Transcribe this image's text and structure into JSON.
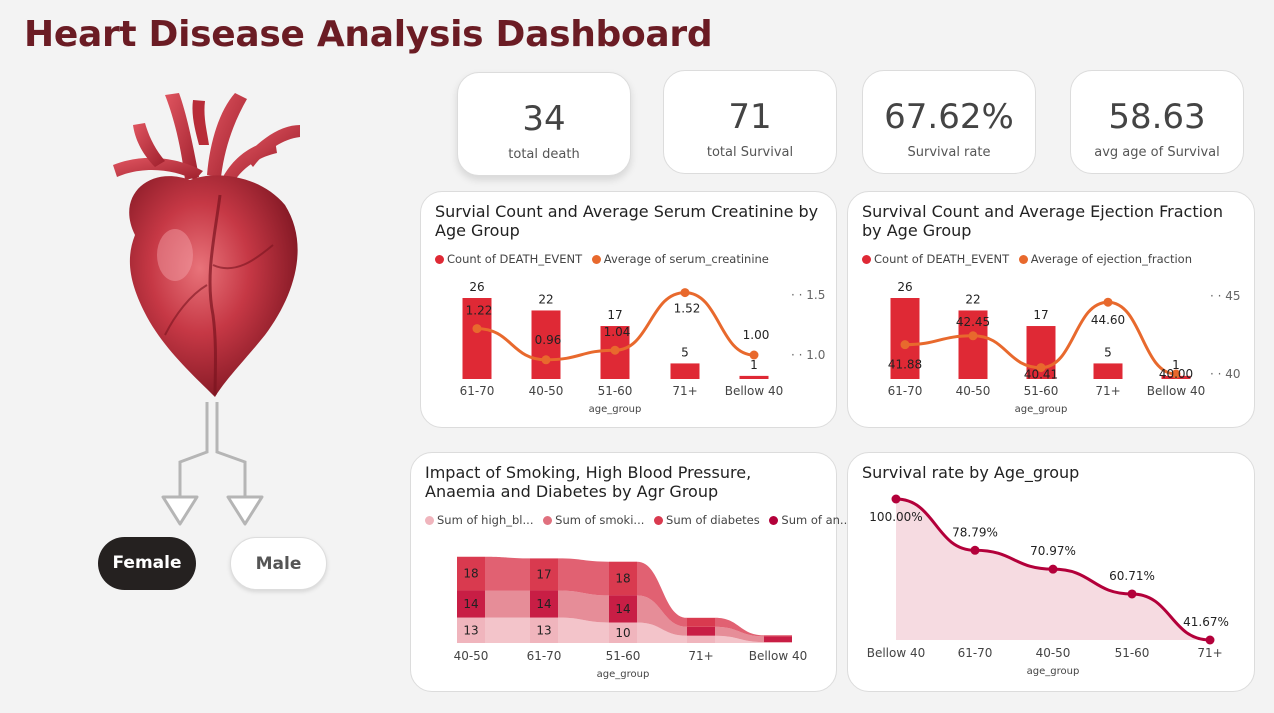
{
  "page": {
    "title": "Heart Disease Analysis Dashboard"
  },
  "kpis": [
    {
      "value": "34",
      "label": "total death"
    },
    {
      "value": "71",
      "label": "total Survival"
    },
    {
      "value": "67.62%",
      "label": "Survival rate"
    },
    {
      "value": "58.63",
      "label": "avg age of Survival"
    }
  ],
  "filters": {
    "female_label": "Female",
    "male_label": "Male",
    "selected": "Female"
  },
  "colors": {
    "bar_red": "#df2935",
    "line_orange": "#e8692d",
    "title_maroon": "#6b1c24",
    "survival_line": "#b3003a",
    "survival_fill": "#f6dbe1"
  },
  "chart_data": [
    {
      "type": "bar",
      "title": "Survial Count and Average Serum Creatinine by Age Group",
      "xlabel": "age_group",
      "categories": [
        "61-70",
        "40-50",
        "51-60",
        "71+",
        "Bellow 40"
      ],
      "series": [
        {
          "name": "Count of DEATH_EVENT",
          "values": [
            26,
            22,
            17,
            5,
            1
          ]
        },
        {
          "name": "Average of serum_creatinine",
          "values": [
            1.22,
            0.96,
            1.04,
            1.52,
            1.0
          ]
        }
      ],
      "bar_labels": [
        "26",
        "22",
        "17",
        "5",
        "1"
      ],
      "line_labels": [
        "1.22",
        "0.96",
        "1.04",
        "1.52",
        "1.00"
      ],
      "y2_ticks": [
        "1.5",
        "1.0"
      ],
      "y2_tick_values": [
        1.5,
        1.0
      ]
    },
    {
      "type": "bar",
      "title": "Survival Count and Average Ejection Fraction by Age Group",
      "xlabel": "age_group",
      "categories": [
        "61-70",
        "40-50",
        "51-60",
        "71+",
        "Bellow 40"
      ],
      "series": [
        {
          "name": "Count of DEATH_EVENT",
          "values": [
            26,
            22,
            17,
            5,
            1
          ]
        },
        {
          "name": "Average of ejection_fraction",
          "values": [
            41.88,
            42.45,
            40.41,
            44.6,
            40.0
          ]
        }
      ],
      "bar_labels": [
        "26",
        "22",
        "17",
        "5",
        "1"
      ],
      "line_labels": [
        "41.88",
        "42.45",
        "40.41",
        "44.60",
        "40.00"
      ],
      "y2_ticks": [
        "45",
        "40"
      ],
      "y2_tick_values": [
        45,
        40
      ]
    },
    {
      "type": "area",
      "title": "Impact of Smoking, High Blood Pressure, Anaemia and Diabetes by Agr Group",
      "xlabel": "age_group",
      "categories": [
        "40-50",
        "61-70",
        "51-60",
        "71+",
        "Bellow 40"
      ],
      "legend": [
        "Sum of high_bl...",
        "Sum of smoki...",
        "Sum of diabetes",
        "Sum of an..."
      ],
      "legend_colors": [
        "#f0b5bd",
        "#e0707e",
        "#d93a4f",
        "#b3003a"
      ],
      "series": [
        {
          "name": "Sum of high_bl...",
          "values": [
            13,
            13,
            10,
            2,
            0
          ]
        },
        {
          "name": "Sum of smoki...",
          "values": [
            14,
            14,
            14,
            3,
            1
          ]
        },
        {
          "name": "Sum of diabetes",
          "values": [
            18,
            17,
            18,
            3,
            0
          ]
        }
      ],
      "labels": [
        {
          "cat": 0,
          "text": "18"
        },
        {
          "cat": 0,
          "text": "14"
        },
        {
          "cat": 0,
          "text": "13"
        },
        {
          "cat": 1,
          "text": "17"
        },
        {
          "cat": 1,
          "text": "14"
        },
        {
          "cat": 1,
          "text": "13"
        },
        {
          "cat": 2,
          "text": "18"
        },
        {
          "cat": 2,
          "text": "14"
        },
        {
          "cat": 2,
          "text": "10"
        }
      ]
    },
    {
      "type": "line",
      "title": "Survival rate by Age_group",
      "xlabel": "age_group",
      "categories": [
        "Bellow 40",
        "61-70",
        "40-50",
        "51-60",
        "71+"
      ],
      "series": [
        {
          "name": "Survival rate",
          "values": [
            100.0,
            78.79,
            70.97,
            60.71,
            41.67
          ]
        }
      ],
      "point_labels": [
        "100.00%",
        "78.79%",
        "70.97%",
        "60.71%",
        "41.67%"
      ]
    }
  ]
}
